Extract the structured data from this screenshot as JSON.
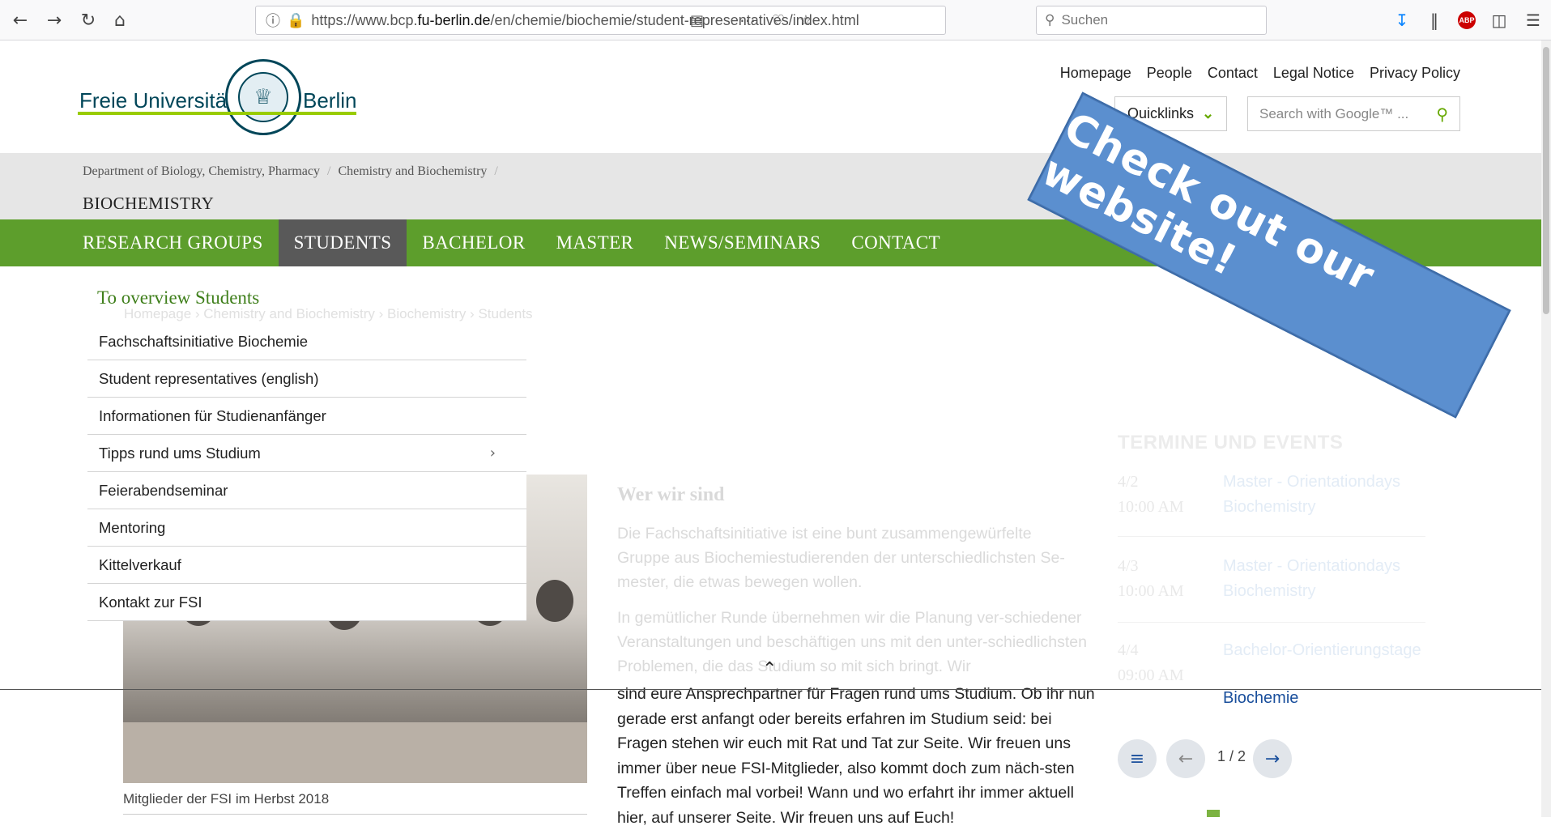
{
  "browser": {
    "url_prefix": "https://www.bcp.",
    "url_domain": "fu-berlin.de",
    "url_path": "/en/chemie/biochemie/student-representatives/index.html",
    "search_placeholder": "Suchen"
  },
  "header": {
    "logo_left": "Freie Universität",
    "logo_right": "Berlin",
    "top_links": [
      "Homepage",
      "People",
      "Contact",
      "Legal Notice",
      "Privacy Policy"
    ],
    "quicklinks_label": "Quicklinks",
    "search_placeholder": "Search with Google™ ..."
  },
  "breadcrumb": {
    "items": [
      "Department of Biology, Chemistry, Pharmacy",
      "Chemistry and Biochemistry"
    ],
    "section_title": "BIOCHEMISTRY"
  },
  "main_nav": {
    "items": [
      "RESEARCH GROUPS",
      "STUDENTS",
      "BACHELOR",
      "MASTER",
      "NEWS/SEMINARS",
      "CONTACT"
    ],
    "active": "STUDENTS"
  },
  "dropdown": {
    "overview_link": "To overview Students",
    "items": [
      "Fachschaftsinitiative Biochemie",
      "Student representatives (english)",
      "Informationen für Studienanfänger",
      "Tipps rund ums Studium",
      "Feierabendseminar",
      "Mentoring",
      "Kittelverkauf",
      "Kontakt zur FSI"
    ]
  },
  "page_breadcrumb": {
    "items": [
      "Homepage",
      "Chemistry and Biochemistry",
      "Biochemistry",
      "Students"
    ]
  },
  "photo": {
    "caption": "Mitglieder der FSI im Herbst 2018"
  },
  "article": {
    "title": "Wer wir sind",
    "p1": "Die Fachschaftsinitiative ist eine bunt zusammengewürfelte Gruppe aus Biochemiestudierenden der unterschiedlichsten Se-mester, die etwas bewegen wollen.",
    "p2_faded": "In gemütlicher Runde übernehmen wir die Planung ver-schiedener Veranstaltungen und beschäftigen uns mit den unter-schiedlichsten Problemen, die das Studium so mit sich bringt. Wir",
    "p2_visible": "sind eure Ansprechpartner für Fragen rund ums Studium. Ob ihr nun gerade erst anfangt oder bereits erfahren im Studium seid: bei Fragen stehen wir euch mit Rat und Tat zur Seite. Wir freuen uns immer über neue FSI-Mitglieder, also kommt doch zum näch-sten Treffen einfach mal vorbei! Wann und wo erfahrt ihr immer aktuell hier, auf unserer Seite. Wir freuen uns auf Euch!"
  },
  "events": {
    "title": "TERMINE UND EVENTS",
    "items": [
      {
        "date": "4/2",
        "time": "10:00 AM",
        "title": "Master - Orientationdays Biochemistry"
      },
      {
        "date": "4/3",
        "time": "10:00 AM",
        "title": "Master - Orientationdays Biochemistry"
      },
      {
        "date": "4/4",
        "time": "09:00 AM",
        "title": "Bachelor-Orientierungstage"
      }
    ],
    "visible_tail": "Biochemie",
    "pager": "1 / 2"
  },
  "banner": {
    "text": "Check out our website!"
  },
  "colors": {
    "nav_green": "#5d9e2c",
    "active_gray": "#595959",
    "banner_blue": "#5b8fcf",
    "link_blue": "#1a4f9c"
  }
}
